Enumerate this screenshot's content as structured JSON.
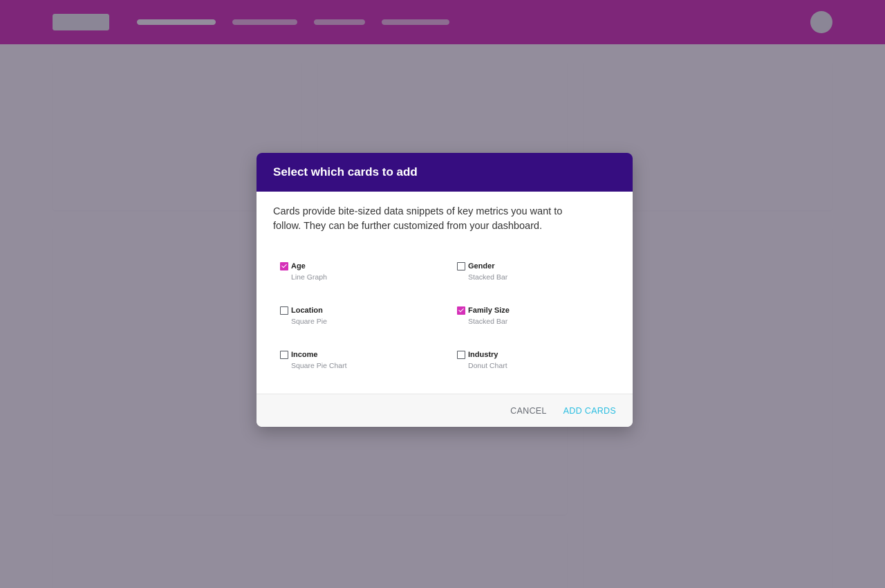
{
  "dialog": {
    "title": "Select which cards to add",
    "description": "Cards provide bite-sized data snippets of key metrics you want to follow. They can be further customized from your dashboard.",
    "options": [
      {
        "label": "Age",
        "subtitle": "Line Graph",
        "checked": true
      },
      {
        "label": "Gender",
        "subtitle": "Stacked Bar",
        "checked": false
      },
      {
        "label": "Location",
        "subtitle": "Square Pie",
        "checked": false
      },
      {
        "label": "Family Size",
        "subtitle": "Stacked Bar",
        "checked": true
      },
      {
        "label": "Income",
        "subtitle": "Square Pie Chart",
        "checked": false
      },
      {
        "label": "Industry",
        "subtitle": "Donut Chart",
        "checked": false
      }
    ],
    "cancel_label": "CANCEL",
    "add_label": "ADD CARDS"
  },
  "colors": {
    "brand": "#d530b8",
    "dialog_header": "#360d80",
    "accent_link": "#29bde0"
  }
}
